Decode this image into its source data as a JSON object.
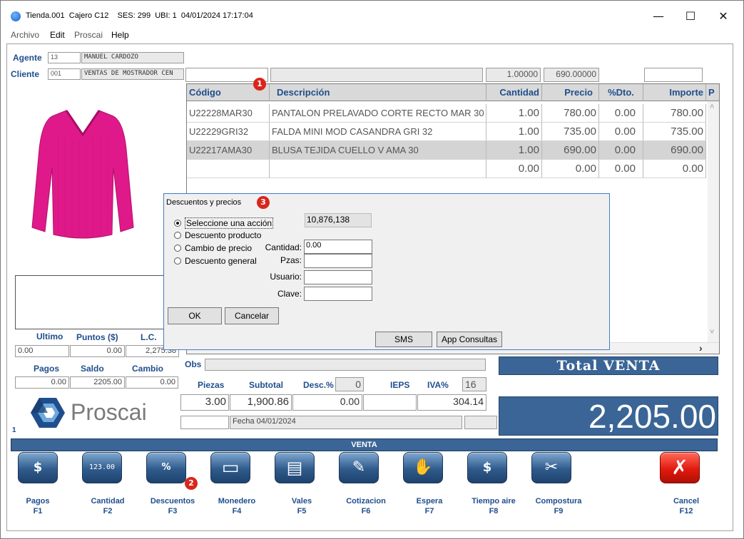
{
  "window": {
    "title": "Tienda.001  Cajero C12    SES: 299  UBI: 1  04/01/2024 17:17:04",
    "min": "—",
    "max": "☐",
    "close": "✕"
  },
  "menu": [
    "Archivo",
    "Edit",
    "Proscai",
    "Help"
  ],
  "agente": {
    "label": "Agente",
    "code": "13",
    "name": "MANUEL CARDOZO"
  },
  "cliente": {
    "label": "Cliente",
    "code": "001",
    "name": "VENTAS DE MOSTRADOR CEN"
  },
  "entry": {
    "code": "",
    "desc": "",
    "qty": "1.00000",
    "price": "690.00000",
    "extra": ""
  },
  "grid": {
    "headers": [
      "Código",
      "Descripción",
      "Cantidad",
      "Precio",
      "%Dto.",
      "Importe",
      "P"
    ],
    "rows": [
      {
        "code": "U22228MAR30",
        "desc": "PANTALON PRELAVADO CORTE RECTO MAR 30",
        "qty": "1.00",
        "price": "780.00",
        "dto": "0.00",
        "imp": "780.00"
      },
      {
        "code": "U22229GRI32",
        "desc": "FALDA MINI MOD CASANDRA GRI 32",
        "qty": "1.00",
        "price": "735.00",
        "dto": "0.00",
        "imp": "735.00"
      },
      {
        "code": "U22217AMA30",
        "desc": "BLUSA TEJIDA CUELLO V AMA 30",
        "qty": "1.00",
        "price": "690.00",
        "dto": "0.00",
        "imp": "690.00"
      },
      {
        "code": "",
        "desc": "",
        "qty": "0.00",
        "price": "0.00",
        "dto": "0.00",
        "imp": "0.00"
      }
    ],
    "scroll_right": "›",
    "scroll_up": "˄",
    "scroll_down": "˅"
  },
  "badges": [
    "1",
    "2",
    "3"
  ],
  "dialog": {
    "title": "Descuentos y precios",
    "options": [
      "Seleccione una acción",
      "Descuento producto",
      "Cambio de precio",
      "Descuento general"
    ],
    "selected": 0,
    "readonly_value": "10,876,138",
    "cantidad_label": "Cantidad:",
    "cantidad": "0.00",
    "pzas_label": "Pzas:",
    "pzas": "",
    "usuario_label": "Usuario:",
    "usuario": "",
    "clave_label": "Clave:",
    "clave": "",
    "ok": "OK",
    "cancelar": "Cancelar",
    "sms": "SMS",
    "app": "App Consultas"
  },
  "stats": {
    "ultimo_label": "Ultimo",
    "puntos_label": "Puntos ($)",
    "lc_label": "L.C.",
    "ultimo": "0.00",
    "puntos": "0.00",
    "lc": "2,275.38",
    "pagos_label": "Pagos",
    "saldo_label": "Saldo",
    "cambio_label": "Cambio",
    "pagos": "0.00",
    "saldo": "2205.00",
    "cambio": "0.00"
  },
  "logo": {
    "text": "Proscai",
    "page_number": "1"
  },
  "obs_label": "Obs",
  "summary": {
    "piezas_label": "Piezas",
    "subtotal_label": "Subtotal",
    "desc_label": "Desc.%",
    "desc_pct": "0",
    "ieps_label": "IEPS",
    "iva_label": "IVA%",
    "iva_pct": "16",
    "piezas": "3.00",
    "subtotal": "1,900.86",
    "desc": "0.00",
    "ieps": "",
    "iva": "304.14",
    "fecha": "Fecha 04/01/2024"
  },
  "total": {
    "label": "Total VENTA",
    "value": "2,205.00"
  },
  "mode_bar": "VENTA",
  "fkeys": [
    {
      "name": "Pagos",
      "key": "F1",
      "glyph": "$"
    },
    {
      "name": "Cantidad",
      "key": "F2",
      "glyph": "123.00"
    },
    {
      "name": "Descuentos",
      "key": "F3",
      "glyph": "%"
    },
    {
      "name": "Monedero",
      "key": "F4",
      "glyph": "▭"
    },
    {
      "name": "Vales",
      "key": "F5",
      "glyph": "▤"
    },
    {
      "name": "Cotizacion",
      "key": "F6",
      "glyph": "✎"
    },
    {
      "name": "Espera",
      "key": "F7",
      "glyph": "✋"
    },
    {
      "name": "Tiempo aire",
      "key": "F8",
      "glyph": "$"
    },
    {
      "name": "Compostura",
      "key": "F9",
      "glyph": "✂"
    },
    {
      "name": "Cancel",
      "key": "F12",
      "glyph": "✗"
    }
  ],
  "colors": {
    "accent": "#3a6596",
    "label_blue": "#1f4e8c",
    "badge_red": "#d9261c",
    "cancel_red": "#e01b0e",
    "product_pink": "#e0198a"
  }
}
